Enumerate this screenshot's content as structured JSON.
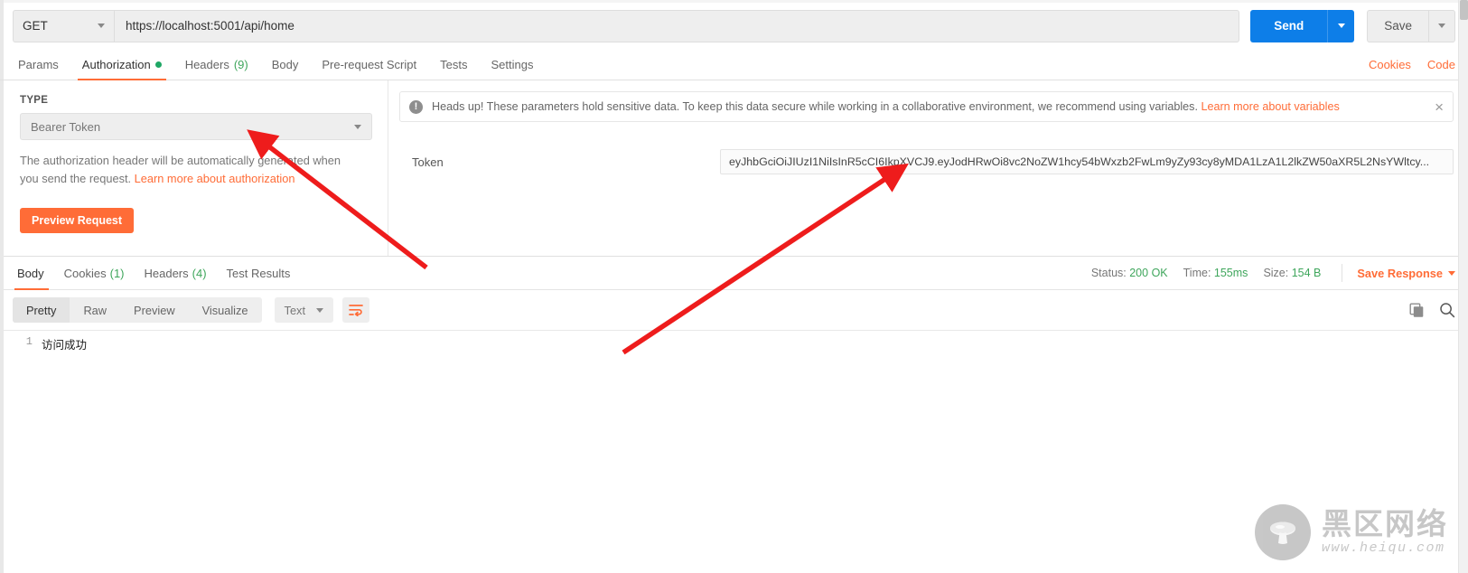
{
  "request": {
    "method": "GET",
    "url": "https://localhost:5001/api/home",
    "send_label": "Send",
    "save_label": "Save"
  },
  "request_tabs": [
    {
      "label": "Params",
      "count": null,
      "dot": false,
      "active": false
    },
    {
      "label": "Authorization",
      "count": null,
      "dot": true,
      "active": true
    },
    {
      "label": "Headers",
      "count": "(9)",
      "dot": false,
      "active": false
    },
    {
      "label": "Body",
      "count": null,
      "dot": false,
      "active": false
    },
    {
      "label": "Pre-request Script",
      "count": null,
      "dot": false,
      "active": false
    },
    {
      "label": "Tests",
      "count": null,
      "dot": false,
      "active": false
    },
    {
      "label": "Settings",
      "count": null,
      "dot": false,
      "active": false
    }
  ],
  "tabbar_right": {
    "cookies": "Cookies",
    "code": "Code"
  },
  "auth": {
    "type_label": "TYPE",
    "type_value": "Bearer Token",
    "help_text": "The authorization header will be automatically generated when you send the request.",
    "help_link": "Learn more about authorization",
    "preview_button": "Preview Request"
  },
  "banner": {
    "icon": "exclamation-circle-icon",
    "text": "Heads up! These parameters hold sensitive data. To keep this data secure while working in a collaborative environment, we recommend using variables.",
    "link": "Learn more about variables",
    "close": "×"
  },
  "token": {
    "label": "Token",
    "value": "eyJhbGciOiJIUzI1NiIsInR5cCI6IkpXVCJ9.eyJodHRwOi8vc2NoZW1hcy54bWxzb2FwLm9yZy93cy8yMDA1LzA1L2lkZW50aXR5L2NsYWltcy..."
  },
  "response_tabs": [
    {
      "label": "Body",
      "count": null,
      "active": true
    },
    {
      "label": "Cookies",
      "count": "(1)",
      "active": false
    },
    {
      "label": "Headers",
      "count": "(4)",
      "active": false
    },
    {
      "label": "Test Results",
      "count": null,
      "active": false
    }
  ],
  "response_meta": {
    "status_label": "Status:",
    "status_value": "200 OK",
    "time_label": "Time:",
    "time_value": "155ms",
    "size_label": "Size:",
    "size_value": "154 B",
    "save_response": "Save Response"
  },
  "viewer": {
    "modes": [
      {
        "label": "Pretty",
        "active": true
      },
      {
        "label": "Raw",
        "active": false
      },
      {
        "label": "Preview",
        "active": false
      },
      {
        "label": "Visualize",
        "active": false
      }
    ],
    "format": "Text",
    "wrap_icon": "wrap-text-icon",
    "copy_icon": "copy-icon",
    "search_icon": "search-icon"
  },
  "response_body": {
    "lines": [
      {
        "number": "1",
        "text": "访问成功"
      }
    ]
  },
  "watermark": {
    "title": "黑区网络",
    "url": "www.heiqu.com"
  },
  "colors": {
    "accent_orange": "#ff6c37",
    "send_blue": "#0d7ee8",
    "status_green": "#3fa65c",
    "dot_green": "#1fa765",
    "annotation_red": "#ee1c1c"
  }
}
